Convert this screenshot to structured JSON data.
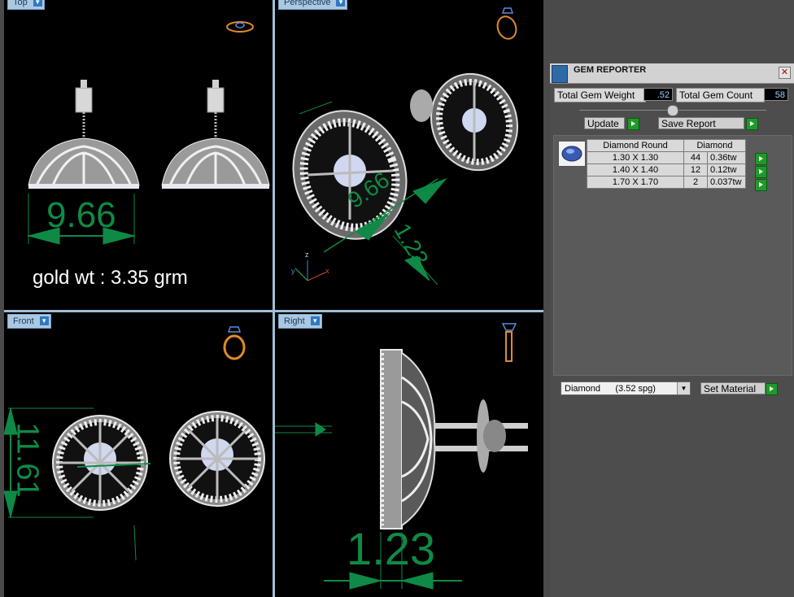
{
  "viewports": {
    "top": {
      "label": "Top"
    },
    "perspective": {
      "label": "Perspective"
    },
    "front": {
      "label": "Front"
    },
    "right": {
      "label": "Right"
    }
  },
  "dimensions": {
    "top_width": "9.66",
    "front_height": "11.61",
    "right_depth": "1.23",
    "persp_a": "9.66",
    "persp_b": "1.23"
  },
  "annotation": {
    "gold_weight": "gold wt : 3.35 grm"
  },
  "axes": {
    "x": "x",
    "y": "y",
    "z": "z"
  },
  "gem_reporter": {
    "title": "GEM REPORTER",
    "close_icon": "close-icon",
    "total_weight_label": "Total Gem Weight",
    "total_weight_value": ".52",
    "total_count_label": "Total Gem Count",
    "total_count_value": "58",
    "update_label": "Update",
    "save_report_label": "Save Report",
    "table": {
      "header_shape": "Diamond Round",
      "header_material": "Diamond",
      "rows": [
        {
          "size": "1.30 X 1.30",
          "count": "44",
          "weight": "0.36tw"
        },
        {
          "size": "1.40 X 1.40",
          "count": "12",
          "weight": "0.12tw"
        },
        {
          "size": "1.70 X 1.70",
          "count": "2",
          "weight": "0.037tw"
        }
      ]
    },
    "material_value": "Diamond      (3.52 spg)",
    "set_material_label": "Set Material"
  },
  "colors": {
    "dimension_green": "#0f8a46",
    "panel_bg": "#4d4d4d",
    "viewport_bg": "#000000"
  }
}
